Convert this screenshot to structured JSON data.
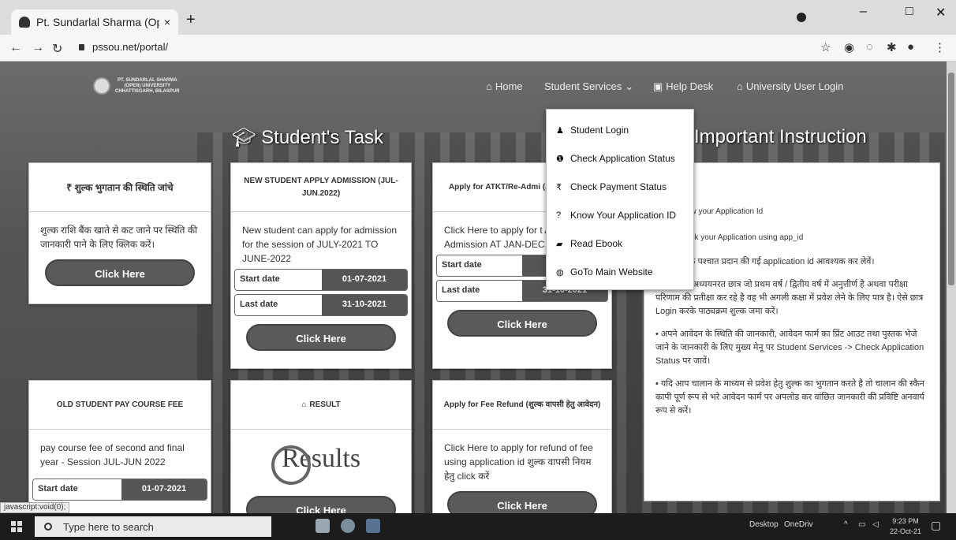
{
  "browser": {
    "tab_title": "Pt. Sundarlal Sharma (Ope",
    "tab_close": "×",
    "new_tab": "+",
    "url": "pssou.net/portal/",
    "win_min": "–",
    "win_max": "□",
    "win_close": "✕"
  },
  "site": {
    "logo_text": "PT. SUNDARLAL SHARMA\n(OPEN) UNIVERSITY\nCHHATTISGARH, BILASPUR",
    "nav": {
      "home": "Home",
      "student_services": "Student Services",
      "help_desk": "Help Desk",
      "university_login": "University User Login"
    },
    "students_task_title": "Student's Task",
    "important_title": "Important Instruction"
  },
  "dropdown": [
    {
      "icon": "user-icon",
      "label": "Student Login"
    },
    {
      "icon": "info-circle-icon",
      "label": "Check Application Status"
    },
    {
      "icon": "rupee-icon",
      "label": "Check Payment Status"
    },
    {
      "icon": "question-icon",
      "label": "Know Your Application ID"
    },
    {
      "icon": "book-icon",
      "label": "Read Ebook"
    },
    {
      "icon": "globe-icon",
      "label": "GoTo Main Website"
    }
  ],
  "cards": {
    "payment_check": {
      "title": "₹ शुल्क भुगतान की स्थिति जांचे",
      "body": "शुल्क राशि बैंक खाते से कट जाने पर स्थिति की जानकारी पाने के लिए क्लिक करें।",
      "button": "Click Here"
    },
    "new_admission": {
      "title": "NEW STUDENT APPLY ADMISSION (JUL-JUN.2022)",
      "body": "New student can apply for admission for the session of JULY-2021 TO JUNE-2022",
      "start_label": "Start date",
      "start_value": "01-07-2021",
      "last_label": "Last date",
      "last_value": "31-10-2021",
      "button": "Click Here"
    },
    "atkt": {
      "title": "Apply for ATKT/Re-Admi (JAN-DEC.202",
      "body": "Click Here to apply for t ATKT/Re-Admission AT JAN-DEC.2021)",
      "start_label": "Start date",
      "start_value": "01-",
      "last_label": "Last date",
      "last_value": "31-10-2021",
      "button": "Click Here"
    },
    "old_student": {
      "title": "OLD STUDENT PAY COURSE FEE",
      "body": "pay course fee of second and final year - Session JUL-JUN 2022",
      "start_label": "Start date",
      "start_value": "01-07-2021"
    },
    "result": {
      "title": "RESULT",
      "image_text": "Results",
      "button": "Click Here"
    },
    "refund": {
      "title": "Apply for Fee Refund (शुल्क वापसी हेतु आवेदन)",
      "body": "Click Here to apply for refund of fee using application id शुल्क वापसी नियम हेतु click करें",
      "button": "Click Here"
    }
  },
  "instructions": [
    "t Login",
    "ere to know your Application Id",
    "ere to check your Application using app_id",
    "े आवेदन के पश्चात प्रदान की गई application id आवश्यक  कर लेवें।",
    "• वि. वि. में अध्ययनरत छात्र जो प्रथम वर्ष / द्वितीय वर्ष में अनुत्तीर्ण है अथवा परीक्षा परिणाम की प्रतीक्षा कर रहे है वह भी अगली कक्षा में प्रवेश लेने के लिए पात्र है। ऐसे छात्र Login करके पाठ्यक्रम शुल्क जमा करें।",
    "• अपने आवेदन के स्थिति की जानकारी, आवेदन फार्म का प्रिंट आउट तथा पुस्तक भेजे जाने के जानकारी के लिए मुख्य मेनू पर Student Services -> Check Application Status पर जावें।",
    "• यदि आप चालान के माध्यम से प्रवेश हेतु शुल्क का भुगतान करते है तो चालान की स्कैन कापी पूर्ण रूप से भरे आवेदन फार्म पर अपलोड कर वांछित जानकारी की प्रविष्टि अनवार्य रूप से करें।"
  ],
  "status_bar": "javascript:void(0);",
  "taskbar": {
    "search_placeholder": "Type here to search",
    "desktop_label": "Desktop",
    "onedrive_label": "OneDriv",
    "time": "9:23 PM",
    "date": "22-Oct-21"
  }
}
